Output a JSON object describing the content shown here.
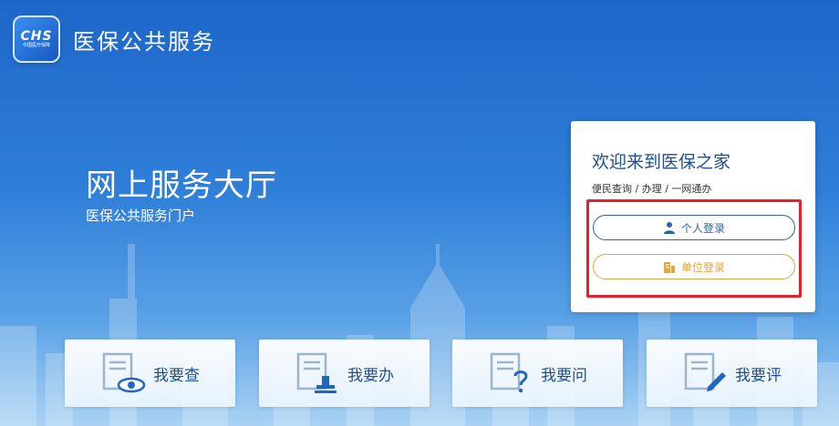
{
  "header": {
    "logo_text": "CHS",
    "logo_subtext": "中国医疗保障",
    "title": "医保公共服务"
  },
  "hero": {
    "title": "网上服务大厅",
    "subtitle": "医保公共服务门户"
  },
  "login": {
    "welcome": "欢迎来到医保之家",
    "tagline": "便民查询 / 办理 / 一网通办",
    "personal_label": "个人登录",
    "org_label": "单位登录"
  },
  "services": [
    {
      "label": "我要查",
      "icon": "eye-document-icon"
    },
    {
      "label": "我要办",
      "icon": "stamp-document-icon"
    },
    {
      "label": "我要问",
      "icon": "question-document-icon"
    },
    {
      "label": "我要评",
      "icon": "pen-document-icon"
    }
  ],
  "colors": {
    "primary": "#1e4f8e",
    "personal_button": "#2f64a8",
    "org_button": "#e3a642",
    "highlight": "#e8202a"
  }
}
